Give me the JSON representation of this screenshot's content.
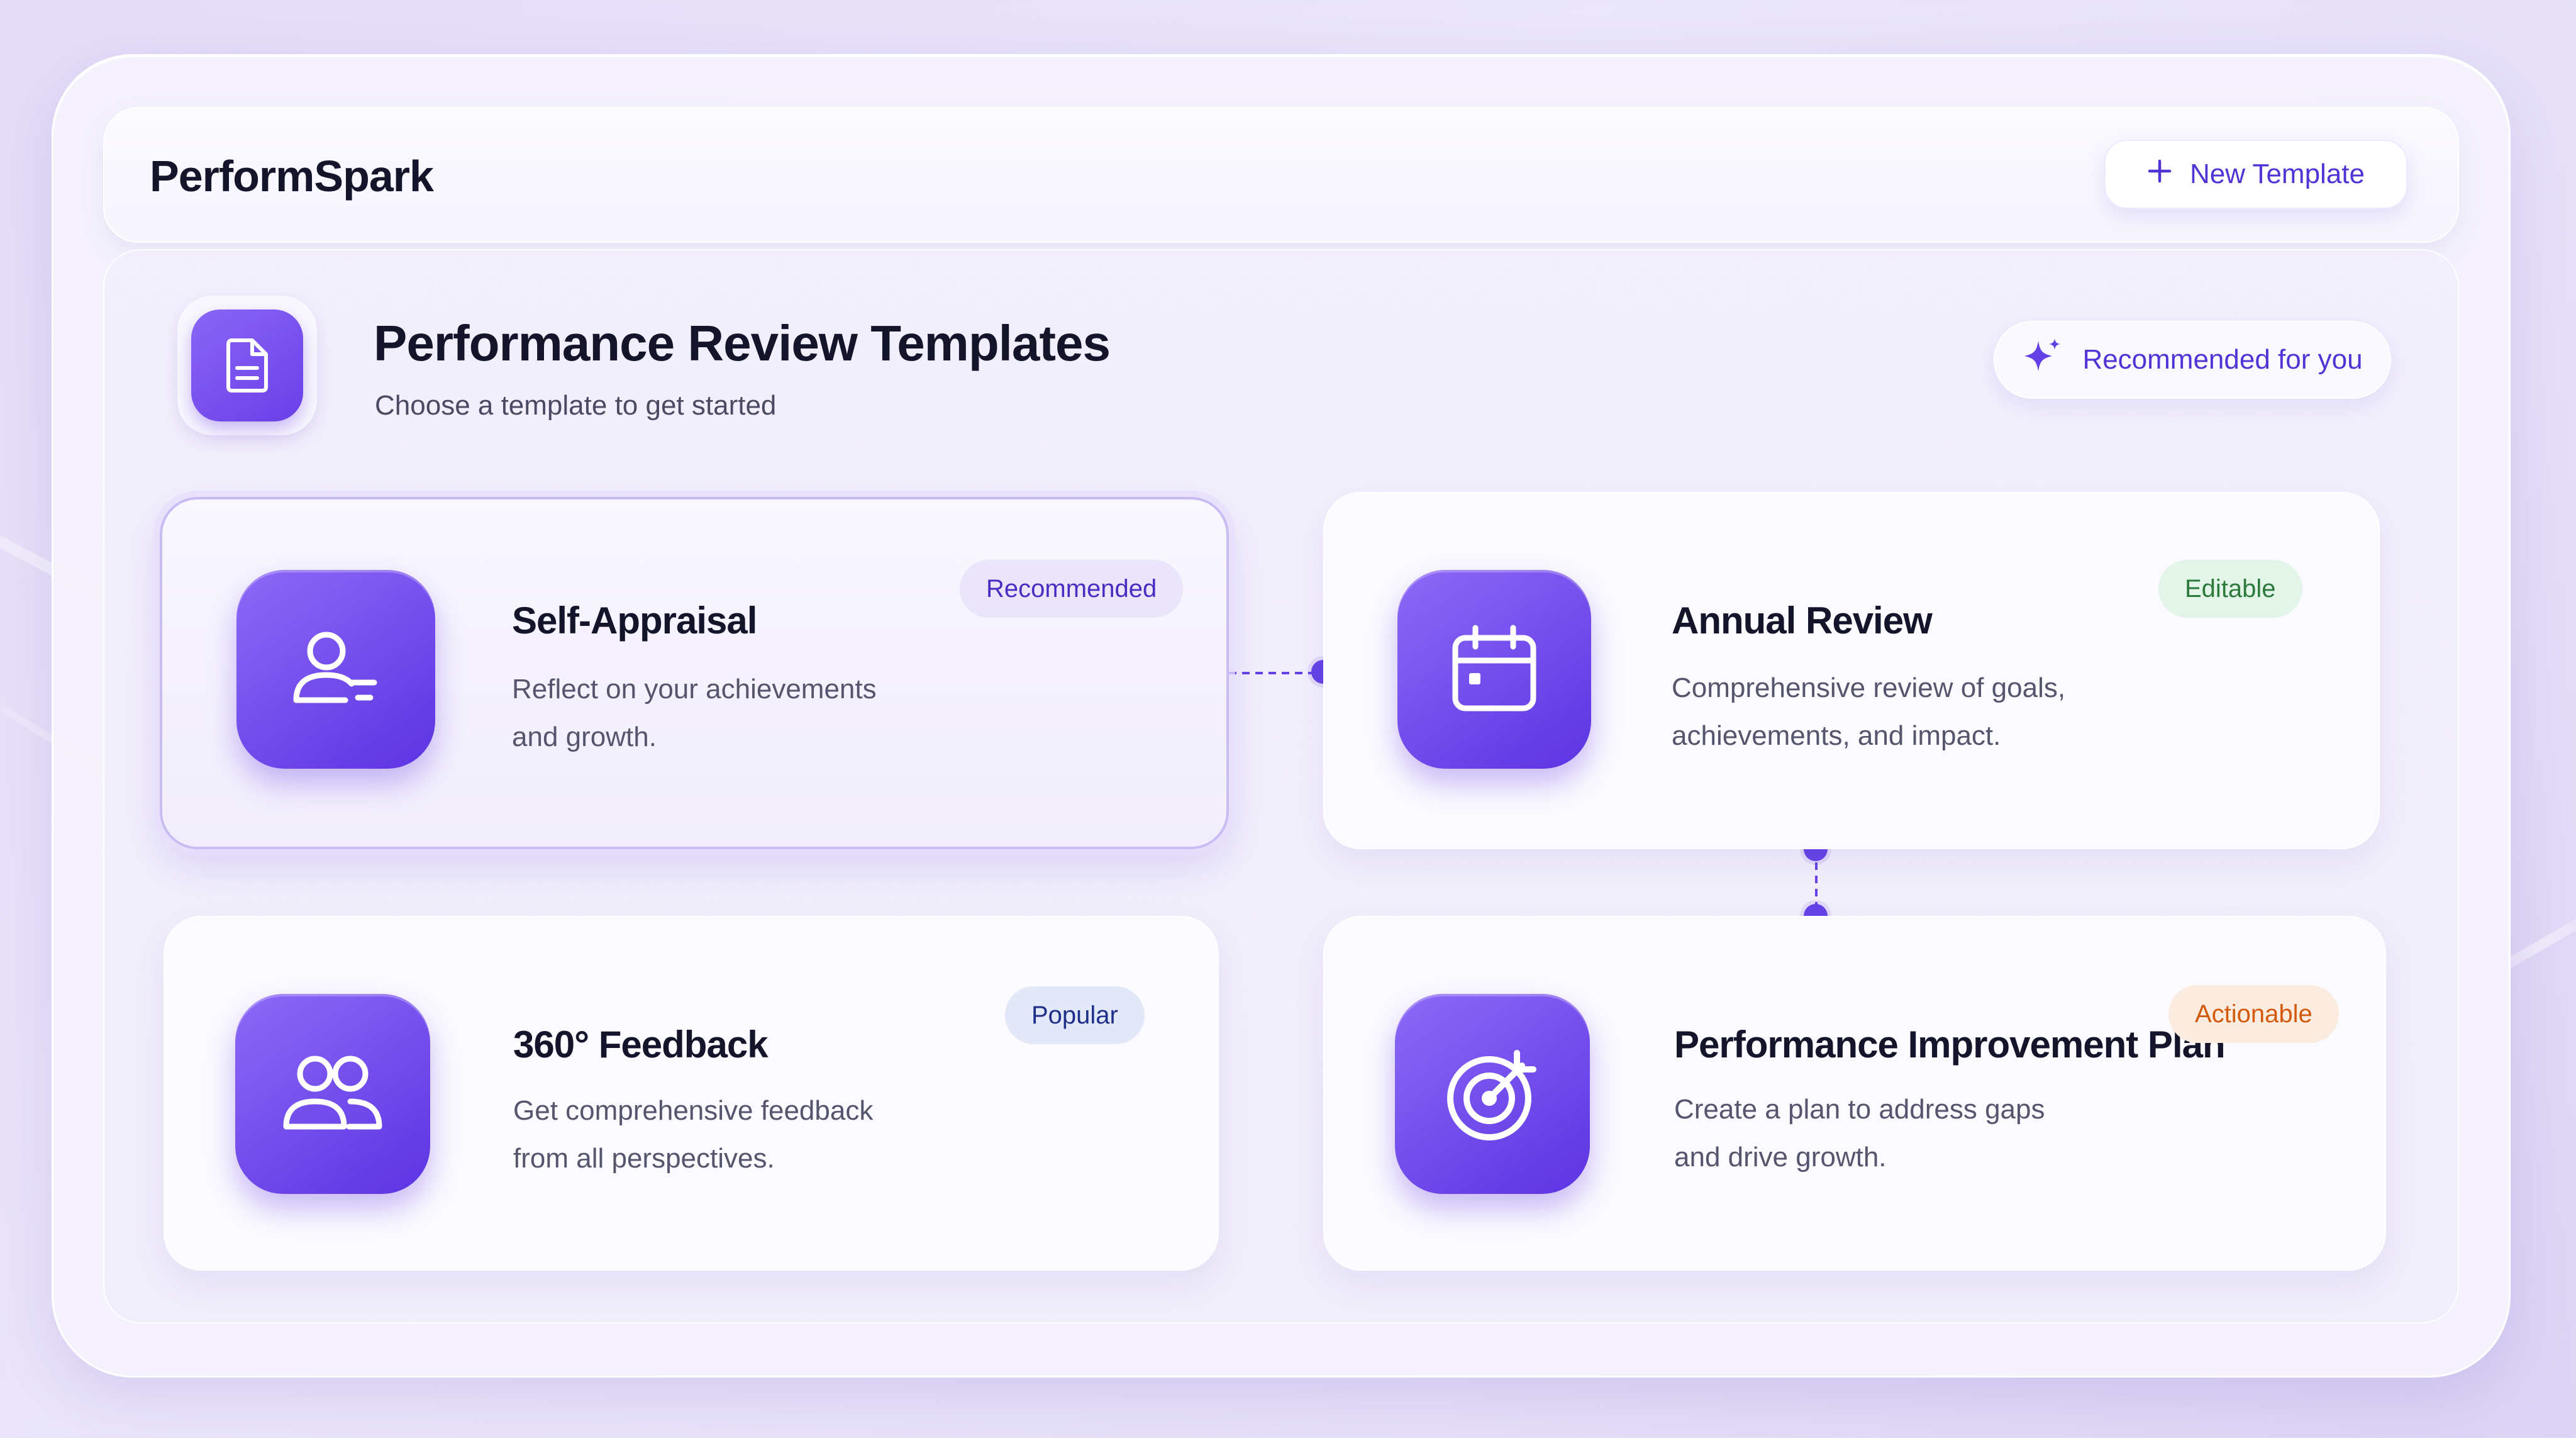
{
  "app": {
    "brand": "PerformSpark",
    "new_template_label": "New Template"
  },
  "header": {
    "title": "Performance Review Templates",
    "subtitle": "Choose a template to get started",
    "recommended_label": "Recommended for you"
  },
  "templates": [
    {
      "title": "Self-Appraisal",
      "desc_line1": "Reflect on your achievements",
      "desc_line2": "and growth.",
      "badge": "Recommended",
      "icon": "user-edit-icon",
      "selected": true
    },
    {
      "title": "Annual Review",
      "desc_line1": "Comprehensive review of goals,",
      "desc_line2": "achievements, and impact.",
      "badge": "Editable",
      "icon": "calendar-icon",
      "selected": false
    },
    {
      "title": "360° Feedback",
      "desc_line1": "Get comprehensive feedback",
      "desc_line2": "from all perspectives.",
      "badge": "Popular",
      "icon": "users-icon",
      "selected": false
    },
    {
      "title": "Performance Improvement Plan",
      "desc_line1": "Create a plan to address gaps",
      "desc_line2": "and drive growth.",
      "badge": "Actionable",
      "icon": "target-icon",
      "selected": false
    }
  ],
  "colors": {
    "accent": "#6a3fe8",
    "badge_recommended": "#4a2cc3",
    "badge_editable": "#2b7a3b",
    "badge_popular": "#1e2f8a",
    "badge_actionable": "#d35a0c"
  }
}
